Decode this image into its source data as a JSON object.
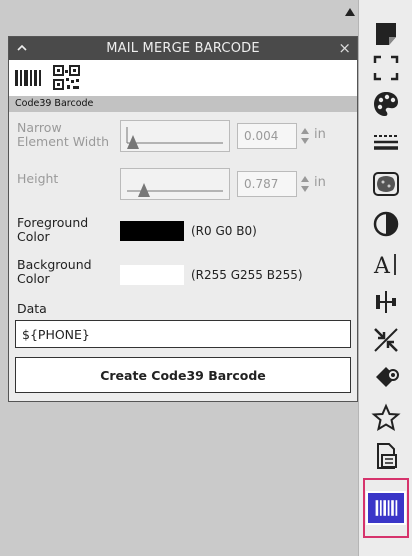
{
  "panel": {
    "title": "MAIL MERGE BARCODE",
    "close_symbol": "×",
    "section_label": "Code39 Barcode",
    "tabs": [
      {
        "icon": "barcode-1d-icon"
      },
      {
        "icon": "qr-code-icon"
      }
    ],
    "narrow_element_width": {
      "label": "Narrow Element Width",
      "value": "0.004",
      "unit": "in"
    },
    "height": {
      "label": "Height",
      "value": "0.787",
      "unit": "in"
    },
    "foreground": {
      "label": "Foreground Color",
      "color": "#000000",
      "rgb": "(R0 G0 B0)"
    },
    "background": {
      "label": "Background Color",
      "color": "#ffffff",
      "rgb": "(R255 G255 B255)"
    },
    "data": {
      "label": "Data",
      "value": "${PHONE}"
    },
    "create_button": "Create Code39 Barcode"
  },
  "toolbar": {
    "items": [
      {
        "icon": "sticky-note-icon"
      },
      {
        "icon": "frame-corners-icon"
      },
      {
        "icon": "palette-icon"
      },
      {
        "icon": "line-style-icon"
      },
      {
        "icon": "texture-fill-icon"
      },
      {
        "icon": "contrast-icon"
      },
      {
        "icon": "text-cursor-icon"
      },
      {
        "icon": "align-center-icon"
      },
      {
        "icon": "shrink-icon"
      },
      {
        "icon": "paint-bucket-icon"
      },
      {
        "icon": "star-icon"
      },
      {
        "icon": "document-icon"
      },
      {
        "icon": "barcode-icon",
        "active": true
      }
    ],
    "accent": "#3a36c8",
    "highlight": "#d6336c"
  }
}
